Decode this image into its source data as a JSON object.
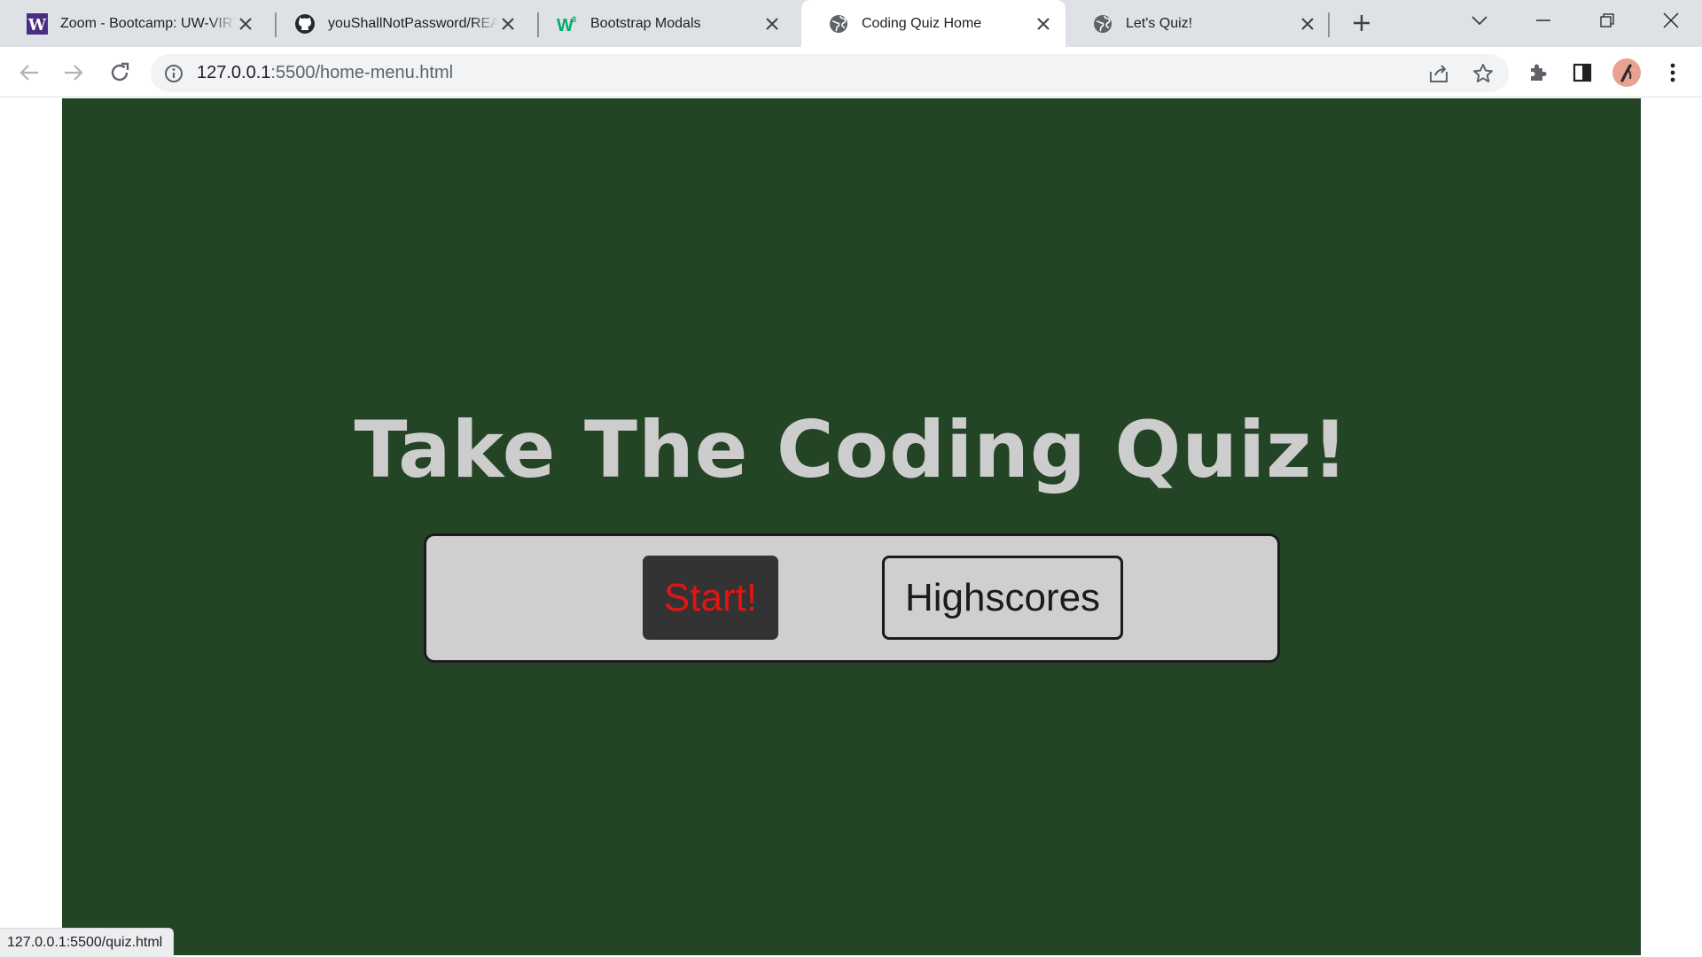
{
  "browser": {
    "tabs": [
      {
        "title": "Zoom - Bootcamp: UW-VIRT-FSF-PT-",
        "favicon": "uw-w-icon",
        "active": false
      },
      {
        "title": "youShallNotPassword/README",
        "favicon": "github-icon",
        "active": false
      },
      {
        "title": "Bootstrap Modals",
        "favicon": "w3schools-icon",
        "active": false
      },
      {
        "title": "Coding Quiz Home",
        "favicon": "globe-icon",
        "active": true
      },
      {
        "title": "Let's Quiz!",
        "favicon": "globe-icon",
        "active": false
      }
    ],
    "address": {
      "host": "127.0.0.1",
      "path": ":5500/home-menu.html"
    },
    "status_url": "127.0.0.1:5500/quiz.html",
    "accent": "#dee1e6"
  },
  "page": {
    "heading": "Take The Coding Quiz!",
    "start_label": "Start!",
    "highscores_label": "Highscores",
    "colors": {
      "background": "#244525",
      "heading": "#cdcdcd",
      "panel": "#cfcfcf",
      "start_bg": "#333333",
      "start_text": "#e01515"
    }
  }
}
